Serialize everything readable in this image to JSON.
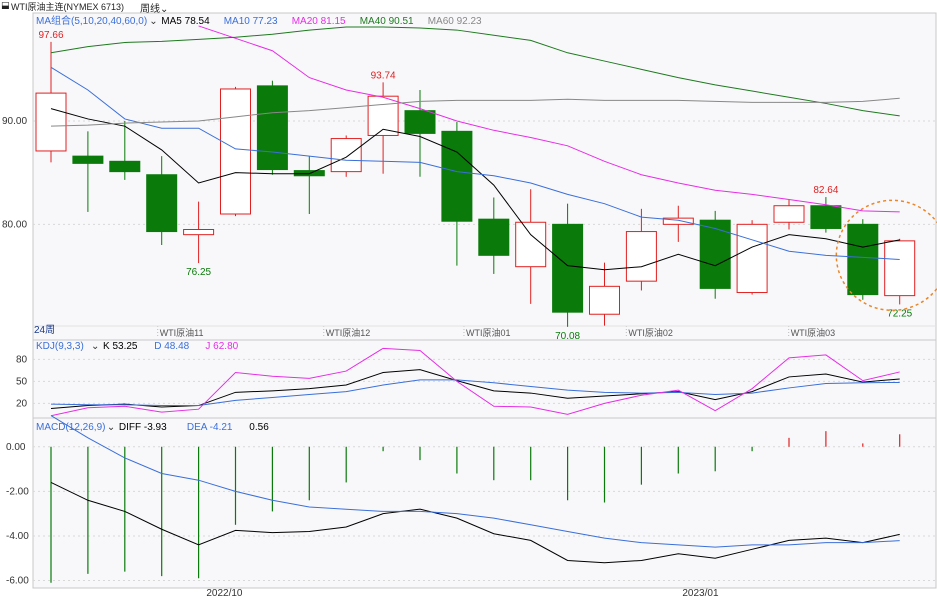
{
  "header": {
    "title": "WTI原油主连(NYMEX 6713)",
    "period_label": "周线"
  },
  "ma_legend": {
    "group": "MA组合(5,10,20,40,60,0)",
    "items": [
      {
        "label": "MA5 78.54",
        "color": "#000000"
      },
      {
        "label": "MA10 77.23",
        "color": "#3a6fd8"
      },
      {
        "label": "MA20 81.15",
        "color": "#e62ee6"
      },
      {
        "label": "MA40 90.51",
        "color": "#1f7a1f"
      },
      {
        "label": "MA60 92.23",
        "color": "#888888"
      }
    ]
  },
  "kdj_legend": {
    "group": "KDJ(9,3,3)",
    "items": [
      {
        "label": "K 53.25",
        "color": "#000000"
      },
      {
        "label": "D 48.48",
        "color": "#3a6fd8"
      },
      {
        "label": "J 62.80",
        "color": "#e62ee6"
      }
    ]
  },
  "macd_legend": {
    "group": "MACD(12,26,9)",
    "items": [
      {
        "label": "DIFF -3.93",
        "color": "#000000"
      },
      {
        "label": "DEA -4.21",
        "color": "#3a6fd8"
      },
      {
        "label": "0.56",
        "color": "#000000"
      }
    ]
  },
  "period_corner": "24周",
  "chart_data": {
    "type": "candlestick",
    "colors": {
      "up": "#e02020",
      "down": "#0a7a0a",
      "grid": "#d8d8d8"
    },
    "price_axis": {
      "ticks": [
        80,
        90
      ],
      "tick_labels": [
        "80.00",
        "90.00"
      ],
      "ylim": [
        69,
        99
      ]
    },
    "kdj_axis": {
      "ticks": [
        20,
        50,
        80
      ],
      "ylim": [
        0,
        105
      ]
    },
    "macd_axis": {
      "ticks": [
        0,
        -2,
        -4,
        -6
      ],
      "tick_labels": [
        "0.00",
        "-2.00",
        "-4.00",
        "-6.00"
      ],
      "ylim": [
        -6.2,
        1.2
      ]
    },
    "contract_labels": [
      "WTI原油11",
      "WTI原油12",
      "WTI原油01",
      "WTI原油02",
      "WTI原油03"
    ],
    "date_labels": [
      "2022/10",
      "2023/01"
    ],
    "annotations": [
      "97.66",
      "76.25",
      "93.74",
      "70.08",
      "82.64",
      "72.25"
    ],
    "candles": [
      {
        "o": 87.1,
        "h": 97.66,
        "l": 86.0,
        "c": 92.7
      },
      {
        "o": 86.6,
        "h": 89.0,
        "l": 81.2,
        "c": 85.9
      },
      {
        "o": 86.1,
        "h": 90.0,
        "l": 84.3,
        "c": 85.1
      },
      {
        "o": 84.8,
        "h": 86.6,
        "l": 78.0,
        "c": 79.3
      },
      {
        "o": 79.0,
        "h": 82.2,
        "l": 76.25,
        "c": 79.5
      },
      {
        "o": 81.0,
        "h": 93.3,
        "l": 80.8,
        "c": 93.1
      },
      {
        "o": 93.4,
        "h": 93.9,
        "l": 84.8,
        "c": 85.3
      },
      {
        "o": 85.2,
        "h": 86.6,
        "l": 81.0,
        "c": 84.7
      },
      {
        "o": 85.1,
        "h": 88.6,
        "l": 84.6,
        "c": 88.3
      },
      {
        "o": 88.6,
        "h": 93.74,
        "l": 84.9,
        "c": 92.4
      },
      {
        "o": 91.0,
        "h": 93.0,
        "l": 84.6,
        "c": 88.8
      },
      {
        "o": 89.0,
        "h": 89.9,
        "l": 76.0,
        "c": 80.3
      },
      {
        "o": 80.5,
        "h": 82.6,
        "l": 75.2,
        "c": 77.0
      },
      {
        "o": 75.9,
        "h": 83.4,
        "l": 72.3,
        "c": 80.2
      },
      {
        "o": 80.0,
        "h": 82.0,
        "l": 70.08,
        "c": 71.5
      },
      {
        "o": 71.3,
        "h": 76.3,
        "l": 70.2,
        "c": 74.0
      },
      {
        "o": 74.5,
        "h": 81.5,
        "l": 73.6,
        "c": 79.3
      },
      {
        "o": 80.0,
        "h": 81.8,
        "l": 78.3,
        "c": 80.6
      },
      {
        "o": 80.4,
        "h": 81.3,
        "l": 72.8,
        "c": 73.8
      },
      {
        "o": 73.4,
        "h": 80.4,
        "l": 73.2,
        "c": 80.0
      },
      {
        "o": 80.2,
        "h": 82.4,
        "l": 79.5,
        "c": 81.8
      },
      {
        "o": 81.8,
        "h": 82.64,
        "l": 79.2,
        "c": 79.6
      },
      {
        "o": 80.0,
        "h": 80.5,
        "l": 72.7,
        "c": 73.2
      },
      {
        "o": 73.1,
        "h": 78.6,
        "l": 72.25,
        "c": 78.4
      }
    ],
    "ma": {
      "MA5": [
        91.2,
        90.2,
        89.5,
        87.2,
        84.0,
        85.0,
        84.9,
        84.9,
        86.5,
        89.2,
        88.5,
        87.0,
        83.8,
        79.0,
        76.0,
        75.6,
        75.9,
        77.1,
        76.0,
        77.8,
        79.0,
        78.6,
        77.8,
        78.5
      ],
      "MA10": [
        95.2,
        93.0,
        90.2,
        89.3,
        89.3,
        87.3,
        87.0,
        86.6,
        86.2,
        86.1,
        86.0,
        85.1,
        84.7,
        84.0,
        82.9,
        82.0,
        80.7,
        80.4,
        79.6,
        78.5,
        77.4,
        77.0,
        76.8,
        76.6
      ],
      "MA20": [
        null,
        null,
        null,
        null,
        99.2,
        98.0,
        96.8,
        94.2,
        93.0,
        92.3,
        91.2,
        90.0,
        89.1,
        88.4,
        87.6,
        86.1,
        84.8,
        84.0,
        83.3,
        82.9,
        82.4,
        81.9,
        81.3,
        81.2
      ],
      "MA40": [
        96.6,
        97.2,
        97.6,
        97.7,
        97.9,
        98.1,
        98.4,
        98.8,
        99.1,
        99.1,
        99.0,
        98.8,
        98.3,
        97.8,
        96.6,
        95.8,
        95.0,
        94.2,
        93.5,
        92.9,
        92.3,
        91.7,
        91.0,
        90.5
      ],
      "MA60": [
        89.5,
        89.6,
        89.8,
        89.9,
        90.0,
        90.4,
        90.8,
        91.0,
        91.3,
        91.6,
        91.9,
        92.0,
        92.0,
        92.0,
        92.1,
        92.0,
        92.0,
        92.0,
        91.9,
        91.8,
        91.8,
        91.8,
        91.9,
        92.2
      ]
    },
    "kdj": {
      "K": [
        13,
        17,
        19,
        15,
        17,
        35,
        37,
        40,
        45,
        62,
        66,
        51,
        37,
        34,
        27,
        30,
        33,
        36,
        25,
        36,
        56,
        60,
        49,
        53.25
      ],
      "D": [
        19,
        18,
        18,
        17,
        17,
        24,
        28,
        32,
        36,
        45,
        52,
        52,
        48,
        43,
        38,
        35,
        34,
        35,
        32,
        34,
        41,
        47,
        48,
        48.48
      ],
      "J": [
        3,
        14,
        16,
        8,
        12,
        62,
        57,
        54,
        64,
        95,
        92,
        50,
        16,
        15,
        5,
        20,
        31,
        38,
        10,
        40,
        82,
        86,
        51,
        62.8
      ]
    },
    "macd": {
      "DIFF": [
        -1.6,
        -2.4,
        -2.9,
        -3.7,
        -4.4,
        -3.75,
        -3.85,
        -3.8,
        -3.6,
        -3.0,
        -2.8,
        -3.2,
        -3.9,
        -4.2,
        -5.1,
        -5.2,
        -5.1,
        -4.8,
        -5.0,
        -4.6,
        -4.2,
        -4.1,
        -4.3,
        -3.93
      ],
      "DEA": [
        1.4,
        0.4,
        -0.5,
        -1.2,
        -1.5,
        -2.0,
        -2.4,
        -2.7,
        -2.8,
        -2.9,
        -2.9,
        -3.0,
        -3.2,
        -3.5,
        -3.8,
        -4.1,
        -4.3,
        -4.4,
        -4.5,
        -4.4,
        -4.4,
        -4.3,
        -4.3,
        -4.21
      ],
      "HIST": [
        -6.1,
        -5.7,
        -5.6,
        -5.8,
        -5.9,
        -3.5,
        -2.9,
        -2.4,
        -1.6,
        -0.2,
        -0.6,
        -1.2,
        -1.5,
        -1.5,
        -2.4,
        -2.5,
        -1.7,
        -1.2,
        -1.1,
        -0.2,
        0.4,
        0.7,
        0.15,
        0.56
      ]
    }
  }
}
